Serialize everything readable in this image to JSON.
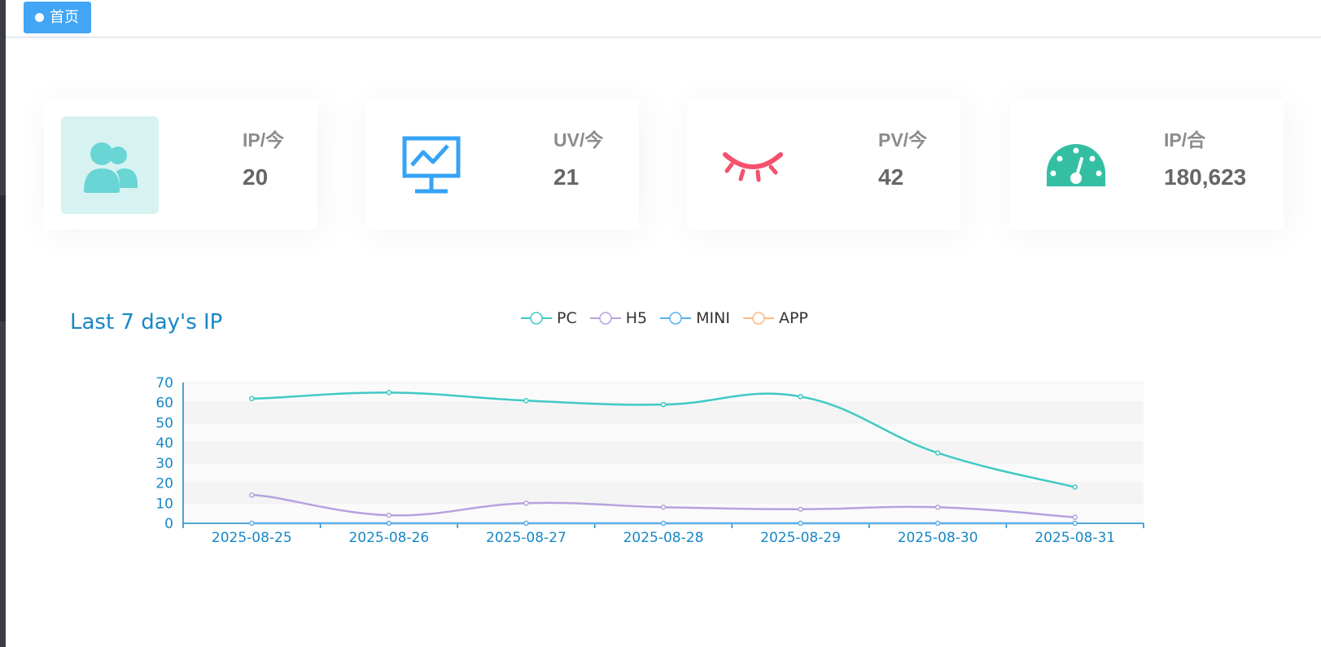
{
  "tabs": {
    "home_label": "首页"
  },
  "cards": [
    {
      "label": "IP/今",
      "value": "20",
      "icon": "users-icon",
      "color": "#69d5d4"
    },
    {
      "label": "UV/今",
      "value": "21",
      "icon": "monitor-chart-icon",
      "color": "#36a3f7"
    },
    {
      "label": "PV/今",
      "value": "42",
      "icon": "eye-closed-icon",
      "color": "#f4516c"
    },
    {
      "label": "IP/合",
      "value": "180,623",
      "icon": "dashboard-gauge-icon",
      "color": "#34bfa3"
    }
  ],
  "chart": {
    "title": "Last 7 day's IP"
  },
  "chart_data": {
    "type": "line",
    "categories": [
      "2025-08-25",
      "2025-08-26",
      "2025-08-27",
      "2025-08-28",
      "2025-08-29",
      "2025-08-30",
      "2025-08-31"
    ],
    "series": [
      {
        "name": "PC",
        "values": [
          62,
          65,
          61,
          59,
          63,
          35,
          18
        ],
        "color": "#40c9c6"
      },
      {
        "name": "H5",
        "values": [
          14,
          4,
          10,
          8,
          7,
          8,
          3
        ],
        "color": "#b6a2de"
      },
      {
        "name": "MINI",
        "values": [
          0,
          0,
          0,
          0,
          0,
          0,
          0
        ],
        "color": "#5ab1ef"
      },
      {
        "name": "APP",
        "values": [
          0,
          0,
          0,
          0,
          0,
          0,
          0
        ],
        "color": "#ffb980"
      }
    ],
    "ylim": [
      0,
      70
    ],
    "yticks": [
      0,
      10,
      20,
      30,
      40,
      50,
      60,
      70
    ],
    "legend_position": "top-center",
    "grid": true,
    "smooth": true
  }
}
